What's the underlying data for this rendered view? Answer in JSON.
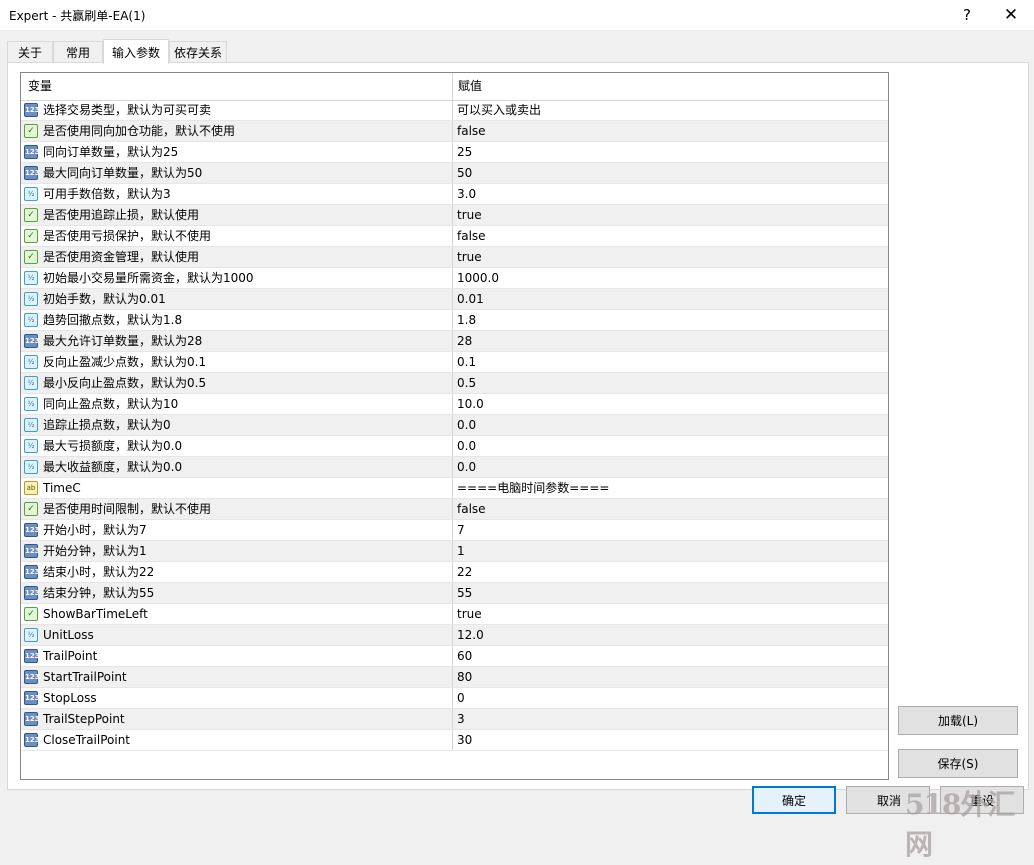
{
  "window": {
    "title": "Expert - 共赢刷单-EA(1)",
    "help_label": "?",
    "close_label": "✕"
  },
  "tabs": [
    {
      "label": "关于"
    },
    {
      "label": "常用"
    },
    {
      "label": "输入参数",
      "active": true
    },
    {
      "label": "依存关系"
    }
  ],
  "table": {
    "columns": [
      "变量",
      "赋值"
    ],
    "rows": [
      {
        "type": "int",
        "name": "选择交易类型，默认为可买可卖",
        "value": "可以买入或卖出"
      },
      {
        "type": "bool",
        "name": "是否使用同向加仓功能，默认不使用",
        "value": "false"
      },
      {
        "type": "int",
        "name": "同向订单数量，默认为25",
        "value": "25"
      },
      {
        "type": "int",
        "name": "最大同向订单数量，默认为50",
        "value": "50"
      },
      {
        "type": "double",
        "name": "可用手数倍数，默认为3",
        "value": "3.0"
      },
      {
        "type": "bool",
        "name": "是否使用追踪止损，默认使用",
        "value": "true"
      },
      {
        "type": "bool",
        "name": "是否使用亏损保护，默认不使用",
        "value": "false"
      },
      {
        "type": "bool",
        "name": "是否使用资金管理，默认使用",
        "value": "true"
      },
      {
        "type": "double",
        "name": "初始最小交易量所需资金，默认为1000",
        "value": "1000.0"
      },
      {
        "type": "double",
        "name": "初始手数，默认为0.01",
        "value": "0.01"
      },
      {
        "type": "double",
        "name": "趋势回撤点数，默认为1.8",
        "value": "1.8"
      },
      {
        "type": "int",
        "name": "最大允许订单数量，默认为28",
        "value": "28"
      },
      {
        "type": "double",
        "name": "反向止盈减少点数，默认为0.1",
        "value": "0.1"
      },
      {
        "type": "double",
        "name": "最小反向止盈点数，默认为0.5",
        "value": "0.5"
      },
      {
        "type": "double",
        "name": "同向止盈点数，默认为10",
        "value": "10.0"
      },
      {
        "type": "double",
        "name": "追踪止损点数，默认为0",
        "value": "0.0"
      },
      {
        "type": "double",
        "name": "最大亏损额度，默认为0.0",
        "value": "0.0"
      },
      {
        "type": "double",
        "name": "最大收益额度，默认为0.0",
        "value": "0.0"
      },
      {
        "type": "string",
        "name": "TimeC",
        "value": "====电脑时间参数===="
      },
      {
        "type": "bool",
        "name": "是否使用时间限制，默认不使用",
        "value": "false"
      },
      {
        "type": "int",
        "name": "开始小时，默认为7",
        "value": "7"
      },
      {
        "type": "int",
        "name": "开始分钟，默认为1",
        "value": "1"
      },
      {
        "type": "int",
        "name": "结束小时，默认为22",
        "value": "22"
      },
      {
        "type": "int",
        "name": "结束分钟，默认为55",
        "value": "55"
      },
      {
        "type": "bool",
        "name": "ShowBarTimeLeft",
        "value": "true"
      },
      {
        "type": "double",
        "name": "UnitLoss",
        "value": "12.0"
      },
      {
        "type": "int",
        "name": "TrailPoint",
        "value": "60"
      },
      {
        "type": "int",
        "name": "StartTrailPoint",
        "value": "80"
      },
      {
        "type": "int",
        "name": "StopLoss",
        "value": "0"
      },
      {
        "type": "int",
        "name": "TrailStepPoint",
        "value": "3"
      },
      {
        "type": "int",
        "name": "CloseTrailPoint",
        "value": "30"
      }
    ]
  },
  "type_icons": {
    "int": {
      "icon": "integer-param-icon",
      "glyph": "123"
    },
    "double": {
      "icon": "double-param-icon",
      "glyph": "½"
    },
    "bool": {
      "icon": "bool-param-icon",
      "glyph": "✓"
    },
    "string": {
      "icon": "string-param-icon",
      "glyph": "ab"
    }
  },
  "buttons": {
    "load": "加载(L)",
    "save": "保存(S)",
    "ok": "确定",
    "cancel": "取消",
    "reset": "重设"
  },
  "watermark": "518外汇网",
  "colors": {
    "accent": "#0078d7",
    "alt_row": "#f0f0f0",
    "dialog_bg": "#f0f0f0"
  }
}
